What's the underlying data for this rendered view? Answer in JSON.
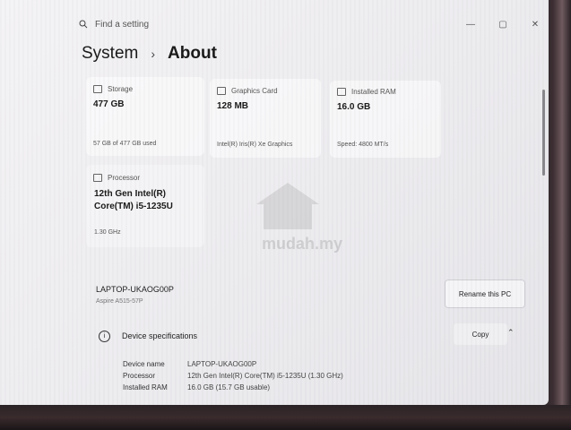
{
  "search": {
    "placeholder": "Find a setting"
  },
  "window_controls": {
    "minimize": "—",
    "maximize": "▢",
    "close": "✕"
  },
  "breadcrumb": {
    "parent": "System",
    "separator": "›",
    "current": "About"
  },
  "storage": {
    "label": "Storage",
    "value": "477 GB",
    "detail": "57 GB of 477 GB used"
  },
  "graphics": {
    "label": "Graphics Card",
    "value": "128 MB",
    "detail": "Intel(R) Iris(R) Xe Graphics"
  },
  "ram": {
    "label": "Installed RAM",
    "value": "16.0 GB",
    "detail": "Speed: 4800 MT/s"
  },
  "processor": {
    "label": "Processor",
    "name_line1": "12th Gen Intel(R)",
    "name_line2": "Core(TM) i5-1235U",
    "speed": "1.30 GHz"
  },
  "device": {
    "name": "LAPTOP-UKAOG00P",
    "model": "Aspire A515-57P",
    "rename_label": "Rename this PC"
  },
  "specs": {
    "title": "Device specifications",
    "copy_label": "Copy",
    "rows": [
      {
        "key": "Device name",
        "value": "LAPTOP-UKAOG00P"
      },
      {
        "key": "Processor",
        "value": "12th Gen Intel(R) Core(TM) i5-1235U (1.30 GHz)"
      },
      {
        "key": "Installed RAM",
        "value": "16.0 GB (15.7 GB usable)"
      }
    ]
  },
  "watermark": {
    "text": "mudah.my"
  }
}
